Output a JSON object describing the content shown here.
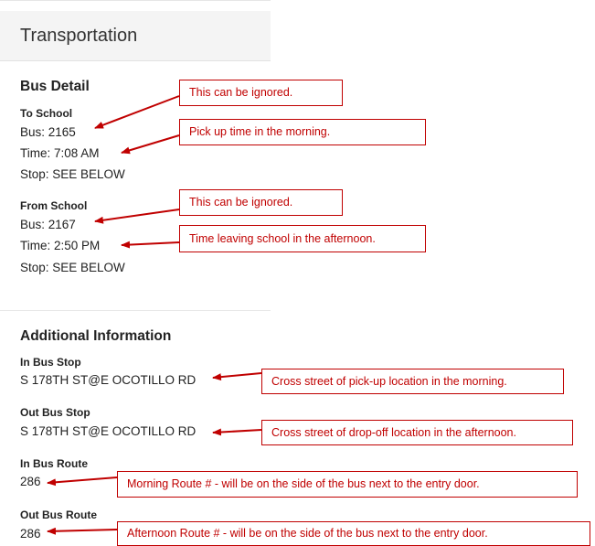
{
  "header": {
    "title": "Transportation"
  },
  "bus_detail": {
    "heading": "Bus Detail",
    "to_school": {
      "label": "To School",
      "bus": "Bus: 2165",
      "time": "Time: 7:08 AM",
      "stop": "Stop: SEE BELOW"
    },
    "from_school": {
      "label": "From School",
      "bus": "Bus: 2167",
      "time": "Time: 2:50 PM",
      "stop": "Stop: SEE BELOW"
    }
  },
  "additional": {
    "heading": "Additional Information",
    "in_bus_stop": {
      "label": "In Bus Stop",
      "value": "S 178TH ST@E OCOTILLO RD"
    },
    "out_bus_stop": {
      "label": "Out Bus Stop",
      "value": "S 178TH ST@E OCOTILLO RD"
    },
    "in_bus_route": {
      "label": "In Bus Route",
      "value": "286"
    },
    "out_bus_route": {
      "label": "Out Bus Route",
      "value": "286"
    }
  },
  "callouts": {
    "to_bus": "This can be ignored.",
    "to_time": "Pick up time in the morning.",
    "from_bus": "This can be ignored.",
    "from_time": "Time leaving school in the afternoon.",
    "in_stop": "Cross street of pick-up location in the morning.",
    "out_stop": "Cross street of drop-off location in the afternoon.",
    "in_route": "Morning Route # - will be on the side of the bus next to the entry door.",
    "out_route": "Afternoon Route # - will be on the side of the bus next to the entry door."
  },
  "colors": {
    "annotation": "#c00000",
    "header_bg": "#f4f4f4"
  }
}
